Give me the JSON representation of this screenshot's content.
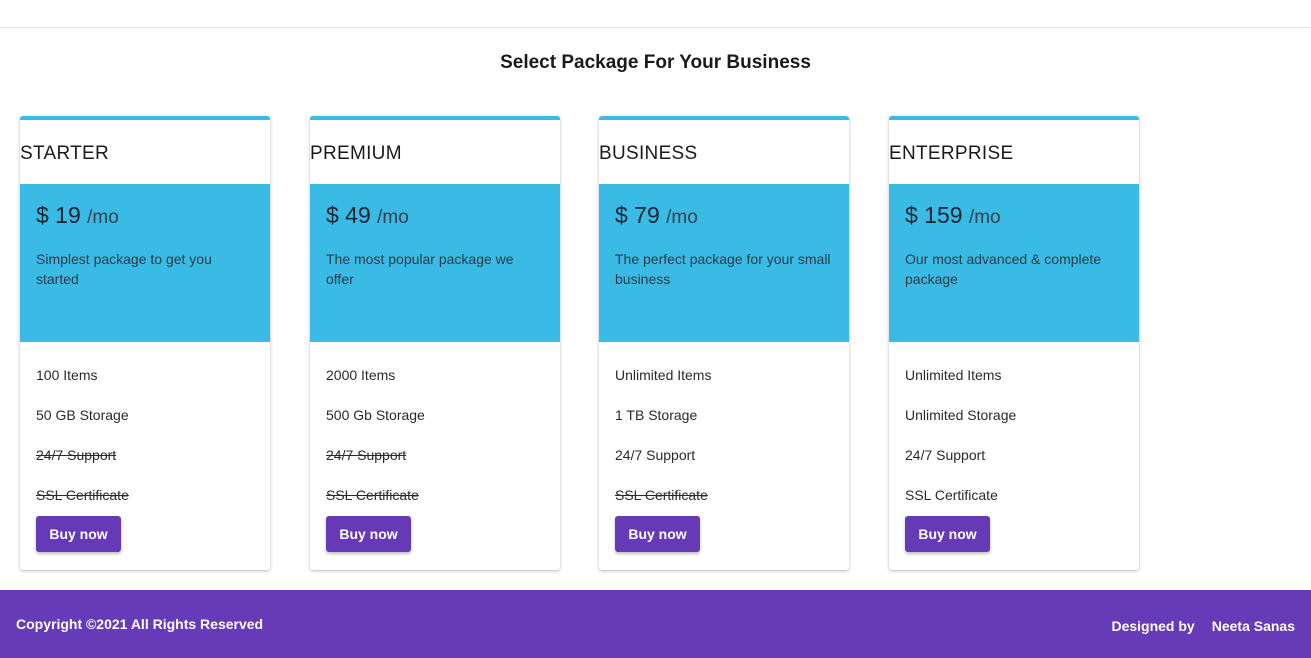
{
  "page": {
    "title": "Select Package For Your Business"
  },
  "plans": [
    {
      "name": "STARTER",
      "price": "$ 19",
      "period": "/mo",
      "tagline": "Simplest package to get you started",
      "features": [
        {
          "label": "100 Items",
          "included": true
        },
        {
          "label": "50 GB Storage",
          "included": true
        },
        {
          "label": "24/7 Support",
          "included": false
        },
        {
          "label": "SSL Certificate",
          "included": false
        }
      ],
      "button": "Buy now"
    },
    {
      "name": "PREMIUM",
      "price": "$ 49",
      "period": "/mo",
      "tagline": "The most popular package we offer",
      "features": [
        {
          "label": "2000 Items",
          "included": true
        },
        {
          "label": "500 Gb Storage",
          "included": true
        },
        {
          "label": "24/7 Support",
          "included": false
        },
        {
          "label": "SSL Certificate",
          "included": false
        }
      ],
      "button": "Buy now"
    },
    {
      "name": "BUSINESS",
      "price": "$ 79",
      "period": "/mo",
      "tagline": "The perfect package for your small business",
      "features": [
        {
          "label": "Unlimited Items",
          "included": true
        },
        {
          "label": "1 TB Storage",
          "included": true
        },
        {
          "label": "24/7 Support",
          "included": true
        },
        {
          "label": "SSL Certificate",
          "included": false
        }
      ],
      "button": "Buy now"
    },
    {
      "name": "ENTERPRISE",
      "price": "$ 159",
      "period": "/mo",
      "tagline": "Our most advanced & complete package",
      "features": [
        {
          "label": "Unlimited Items",
          "included": true
        },
        {
          "label": "Unlimited Storage",
          "included": true
        },
        {
          "label": "24/7 Support",
          "included": true
        },
        {
          "label": "SSL Certificate",
          "included": true
        }
      ],
      "button": "Buy now"
    }
  ],
  "footer": {
    "copyright": "Copyright ©2021 All Rights Reserved",
    "designed_by_label": "Designed by",
    "designer": "Neeta Sanas"
  },
  "colors": {
    "accent_blue": "#39bbe5",
    "brand_purple": "#673ab7",
    "button_purple": "#6639b6"
  }
}
